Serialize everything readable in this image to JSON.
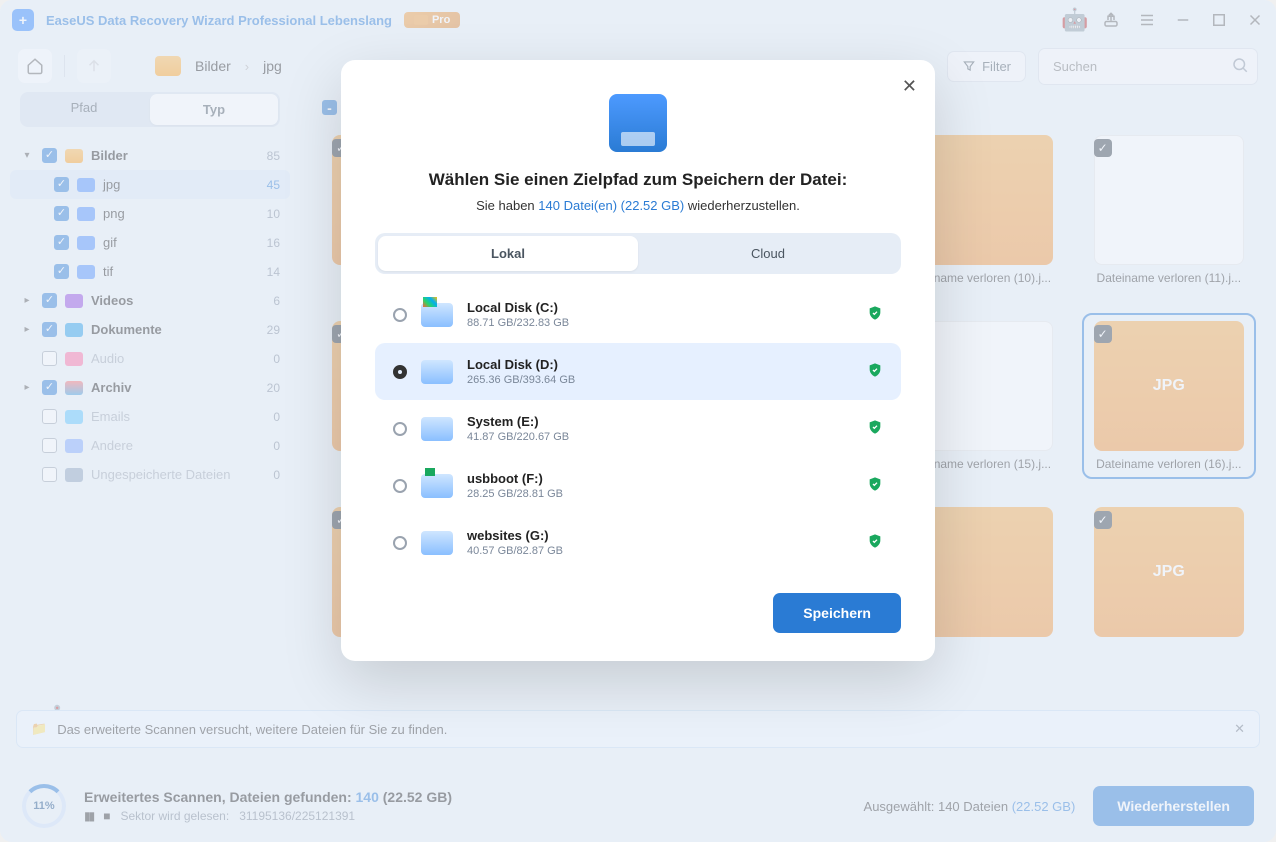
{
  "app": {
    "title": "EaseUS Data Recovery Wizard Professional Lebenslang",
    "badge": "Pro"
  },
  "breadcrumb": {
    "root": "Bilder",
    "leaf": "jpg"
  },
  "toolbar": {
    "filter": "Filter",
    "search_placeholder": "Suchen"
  },
  "sidebar_tabs": {
    "path": "Pfad",
    "type": "Typ"
  },
  "tree": {
    "bilder": {
      "label": "Bilder",
      "count": 85
    },
    "jpg": {
      "label": "jpg",
      "count": 45
    },
    "png": {
      "label": "png",
      "count": 10
    },
    "gif": {
      "label": "gif",
      "count": 16
    },
    "tif": {
      "label": "tif",
      "count": 14
    },
    "videos": {
      "label": "Videos",
      "count": 6
    },
    "dokumente": {
      "label": "Dokumente",
      "count": 29
    },
    "audio": {
      "label": "Audio",
      "count": 0
    },
    "archiv": {
      "label": "Archiv",
      "count": 20
    },
    "emails": {
      "label": "Emails",
      "count": 0
    },
    "andere": {
      "label": "Andere",
      "count": 0
    },
    "ungespeicherte": {
      "label": "Ungespeicherte Dateien",
      "count": 0
    }
  },
  "files": {
    "f10": "Dateiname verloren (10).j...",
    "f11": "Dateiname verloren (11).j...",
    "f15": "Dateiname verloren (15).j...",
    "f16": "Dateiname verloren (16).j..."
  },
  "jpg_label": "JPG",
  "toast": "Das erweiterte Scannen versucht, weitere Dateien für Sie zu finden.",
  "status": {
    "percent": "11%",
    "title_prefix": "Erweitertes Scannen, Dateien gefunden: ",
    "count": "140",
    "size": " (22.52 GB)",
    "sector_prefix": "Sektor wird gelesen: ",
    "sector": "31195136/225121391",
    "selected_prefix": "Ausgewählt: ",
    "selected_count": "140 Dateien ",
    "selected_size": "(22.52 GB)",
    "restore": "Wiederherstellen"
  },
  "modal": {
    "title": "Wählen Sie einen Zielpfad zum Speichern der Datei:",
    "sub_pre": "Sie haben ",
    "sub_link": "140 Datei(en) (22.52 GB)",
    "sub_post": " wiederherzustellen.",
    "tab_local": "Lokal",
    "tab_cloud": "Cloud",
    "save": "Speichern",
    "drives": [
      {
        "name": "Local Disk (C:)",
        "size": "88.71 GB/232.83 GB",
        "icon": "win"
      },
      {
        "name": "Local Disk (D:)",
        "size": "265.36 GB/393.64 GB",
        "icon": "hdd",
        "selected": true
      },
      {
        "name": "System (E:)",
        "size": "41.87 GB/220.67 GB",
        "icon": "hdd"
      },
      {
        "name": "usbboot (F:)",
        "size": "28.25 GB/28.81 GB",
        "icon": "usb"
      },
      {
        "name": "websites (G:)",
        "size": "40.57 GB/82.87 GB",
        "icon": "hdd"
      }
    ]
  }
}
